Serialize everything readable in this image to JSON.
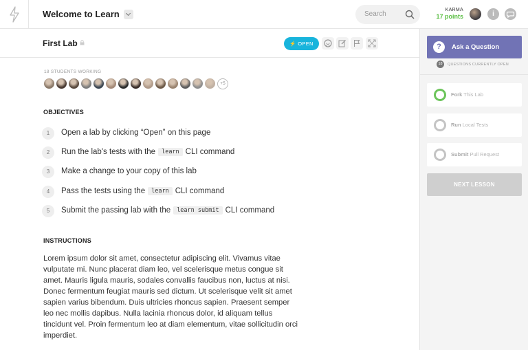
{
  "header": {
    "logo_icon": "lightning-bolt-icon",
    "title": "Welcome to Learn",
    "search_placeholder": "Search",
    "karma_label": "KARMA",
    "karma_points": "17 points",
    "info_icon_glyph": "i"
  },
  "lab": {
    "title": "First Lab",
    "open_label": "OPEN",
    "tools": [
      "github-icon",
      "edit-icon",
      "flag-icon",
      "fullscreen-icon"
    ]
  },
  "students": {
    "label": "18 STUDENTS WORKING",
    "more_label": "+5",
    "avatar_colors": [
      "#8b7a6a",
      "#4a3b33",
      "#5a4a3e",
      "#7d7d7d",
      "#3d4854",
      "#a48a78",
      "#2b2b2b",
      "#3a2f2a",
      "#b09b8a",
      "#6d5a48",
      "#9a8470",
      "#5d5d5d",
      "#8e8e8e",
      "#c0b0a2"
    ]
  },
  "objectives": {
    "heading": "OBJECTIVES",
    "items": [
      {
        "num": "1",
        "before": "Open a lab by clicking “Open” on this page",
        "code": "",
        "after": ""
      },
      {
        "num": "2",
        "before": "Run the lab's tests with the",
        "code": "learn",
        "after": "CLI command"
      },
      {
        "num": "3",
        "before": "Make a change to your copy of this lab",
        "code": "",
        "after": ""
      },
      {
        "num": "4",
        "before": "Pass the tests using the",
        "code": "learn",
        "after": "CLI command"
      },
      {
        "num": "5",
        "before": "Submit the passing lab with the",
        "code": "learn submit",
        "after": "CLI command"
      }
    ]
  },
  "instructions": {
    "heading": "INSTRUCTIONS",
    "body": "Lorem ipsum dolor sit amet, consectetur adipiscing elit. Vivamus vitae vulputate mi. Nunc placerat diam leo, vel scelerisque metus congue sit amet. Mauris ligula mauris, sodales convallis faucibus non, luctus at nisi. Donec fermentum feugiat mauris sed dictum. Ut scelerisque velit sit amet sapien varius bibendum. Duis ultricies rhoncus sapien. Praesent semper leo nec mollis dapibus. Nulla lacinia rhoncus dolor, id aliquam tellus tincidunt vel. Proin fermentum leo at diam elementum, vitae sollicitudin orci imperdiet."
  },
  "sidebar": {
    "ask_label": "Ask a Question",
    "ask_icon_glyph": "?",
    "questions_count": "18",
    "questions_label": "QUESTIONS CURRENTLY OPEN",
    "steps": [
      {
        "action": "Fork",
        "rest": "This Lab",
        "color": "#6cc45a"
      },
      {
        "action": "Run",
        "rest": "Local Tests",
        "color": "#c4c4c4"
      },
      {
        "action": "Submit",
        "rest": "Pull Request",
        "color": "#c4c4c4"
      }
    ],
    "next_label": "NEXT LESSON"
  },
  "colors": {
    "accent_open": "#18b4dc",
    "ask_purple": "#7173b5",
    "karma_green": "#5cbf45"
  }
}
